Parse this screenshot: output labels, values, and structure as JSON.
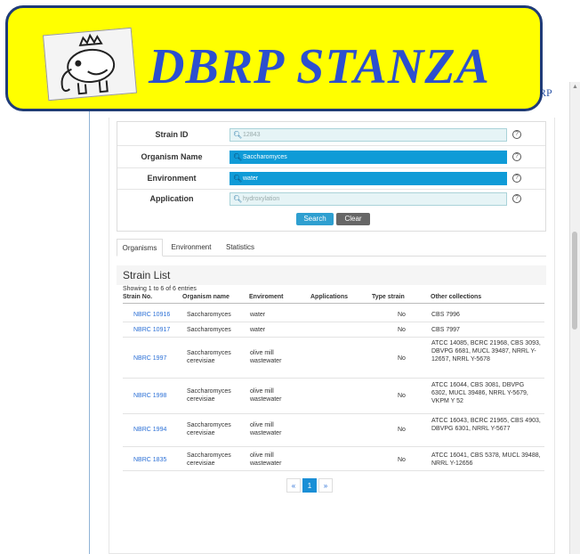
{
  "banner": {
    "title": "DBRP STANZA",
    "logo_icon": "elephant-crown-icon"
  },
  "frame": {
    "top_right_text": "RP"
  },
  "search": {
    "rows": [
      {
        "label": "Strain ID",
        "value": "12843",
        "filled": false
      },
      {
        "label": "Organism Name",
        "value": "Saccharomyces",
        "filled": true
      },
      {
        "label": "Environment",
        "value": "water",
        "filled": true
      },
      {
        "label": "Application",
        "value": "hydroxylation",
        "filled": false
      }
    ],
    "search_label": "Search",
    "clear_label": "Clear"
  },
  "tabs": [
    {
      "label": "Organisms",
      "active": true
    },
    {
      "label": "Environment",
      "active": false
    },
    {
      "label": "Statistics",
      "active": false
    }
  ],
  "list": {
    "title": "Strain List",
    "showing": "Showing 1 to 6 of 6 entries",
    "columns": [
      "Strain No.",
      "Organism name",
      "Enviroment",
      "Applications",
      "Type strain",
      "Other collections"
    ],
    "rows": [
      {
        "strain": "NBRC 10916",
        "organism": "Saccharomyces",
        "environment": "water",
        "applications": "",
        "type_strain": "No",
        "collections": "CBS 7996"
      },
      {
        "strain": "NBRC 10917",
        "organism": "Saccharomyces",
        "environment": "water",
        "applications": "",
        "type_strain": "No",
        "collections": "CBS 7997"
      },
      {
        "strain": "NBRC 1997",
        "organism": "Saccharomyces cerevisiae",
        "environment": "olive mill wastewater",
        "applications": "",
        "type_strain": "No",
        "collections": "ATCC 14085, BCRC 21968, CBS 3093, DBVPG 6681, MUCL 39487, NRRL Y-12657, NRRL Y-5678"
      },
      {
        "strain": "NBRC 1998",
        "organism": "Saccharomyces cerevisiae",
        "environment": "olive mill wastewater",
        "applications": "",
        "type_strain": "No",
        "collections": "ATCC 16044, CBS 3081, DBVPG 6302, MUCL 39486, NRRL Y-5679, VKPM Y 52"
      },
      {
        "strain": "NBRC 1994",
        "organism": "Saccharomyces cerevisiae",
        "environment": "olive mill wastewater",
        "applications": "",
        "type_strain": "No",
        "collections": "ATCC 16043, BCRC 21965, CBS 4903, DBVPG 6301, NRRL Y-5677"
      },
      {
        "strain": "NBRC 1835",
        "organism": "Saccharomyces cerevisiae",
        "environment": "olive mill wastewater",
        "applications": "",
        "type_strain": "No",
        "collections": "ATCC 16041, CBS 5378, MUCL 39488, NRRL Y-12656"
      }
    ]
  },
  "pagination": {
    "prev": "«",
    "current": "1",
    "next": "»"
  },
  "colors": {
    "banner_bg": "#ffff00",
    "banner_border": "#1f3b78",
    "title": "#2c4fcf",
    "accent": "#0f9bd7",
    "link": "#2a6fd6"
  }
}
